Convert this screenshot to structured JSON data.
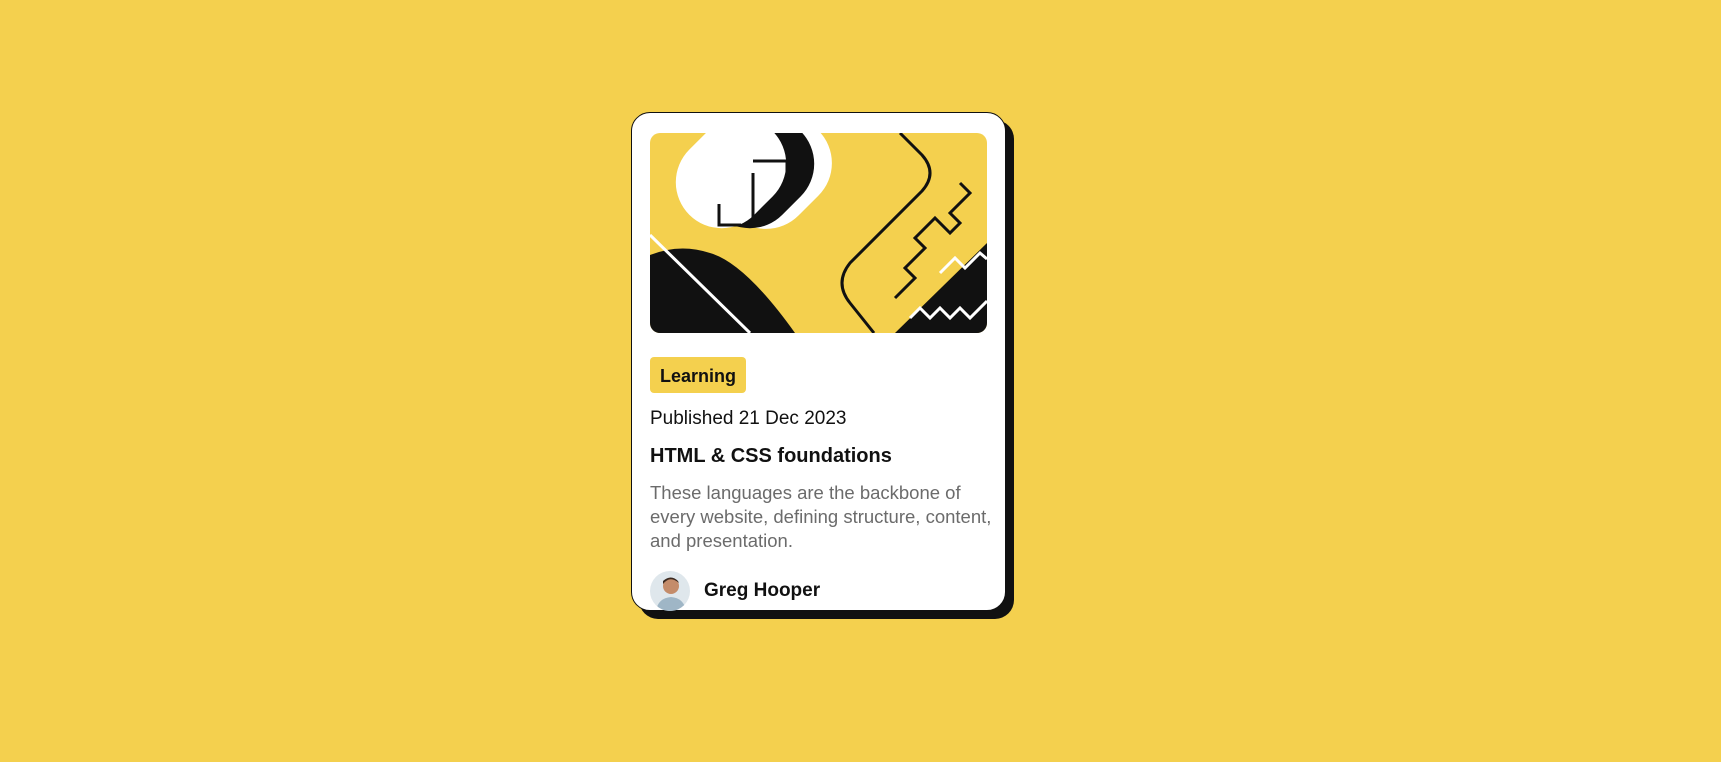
{
  "card": {
    "tag": "Learning",
    "published": "Published 21 Dec 2023",
    "title": "HTML & CSS foundations",
    "description": "These languages are the backbone of every website, defining structure, content, and presentation.",
    "author": "Greg Hooper"
  },
  "colors": {
    "background": "#f4d04e",
    "card": "#ffffff",
    "ink": "#111111",
    "muted": "#6b6b6b"
  },
  "icons": {
    "hero": "html-css-illustration",
    "avatar": "author-avatar"
  }
}
